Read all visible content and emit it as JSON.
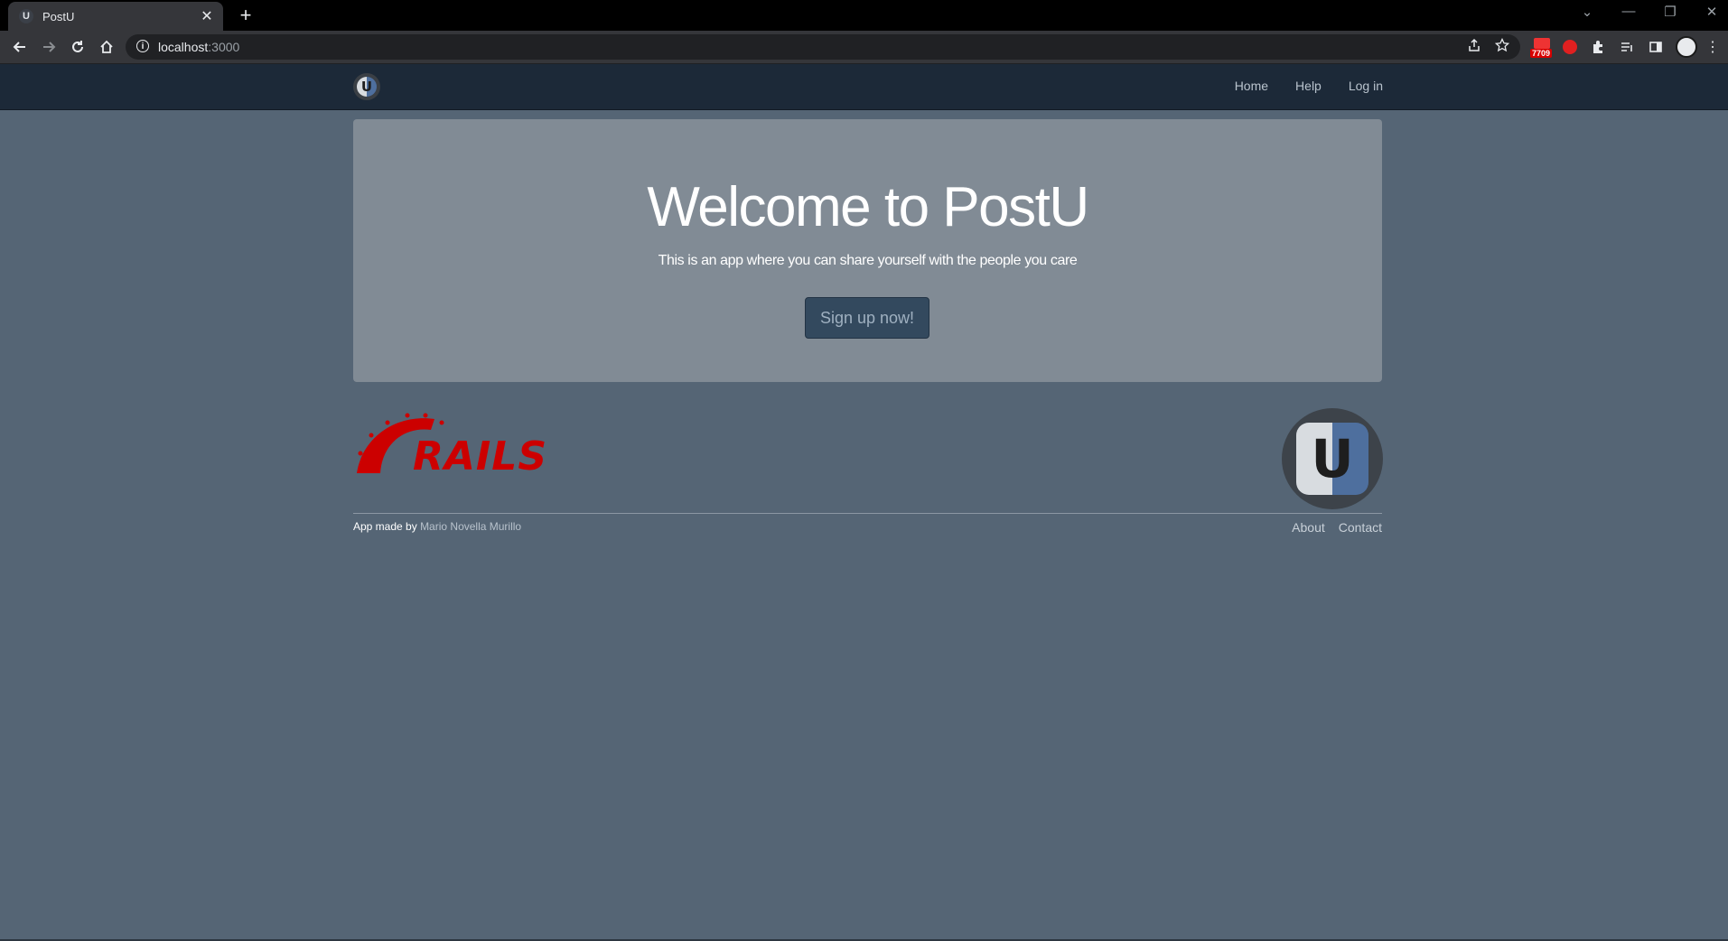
{
  "browser": {
    "tab_title": "PostU",
    "tab_close": "✕",
    "new_tab": "+",
    "favicon_letter": "U",
    "url_host": "localhost",
    "url_port": ":3000",
    "info_glyph": "i",
    "mail_badge": "7709",
    "window_controls": [
      "⌄",
      "—",
      "❐",
      "✕"
    ]
  },
  "navbar": {
    "logo_letter": "U",
    "links": [
      "Home",
      "Help",
      "Log in"
    ]
  },
  "hero": {
    "title": "Welcome to PostU",
    "subtitle": "This is an app where you can share yourself with the people you care",
    "cta_label": "Sign up now!"
  },
  "footer": {
    "rails_text": "RAILS",
    "logo_letter": "U",
    "credit_prefix": "App made by",
    "credit_author": "Mario Novella Murillo",
    "links": [
      "About",
      "Contact"
    ]
  },
  "colors": {
    "page_bg": "#556575",
    "navbar_bg": "#1c2938",
    "jumbotron_bg": "#818b95",
    "button_bg": "#33495e",
    "rails_red": "#cc0000"
  }
}
